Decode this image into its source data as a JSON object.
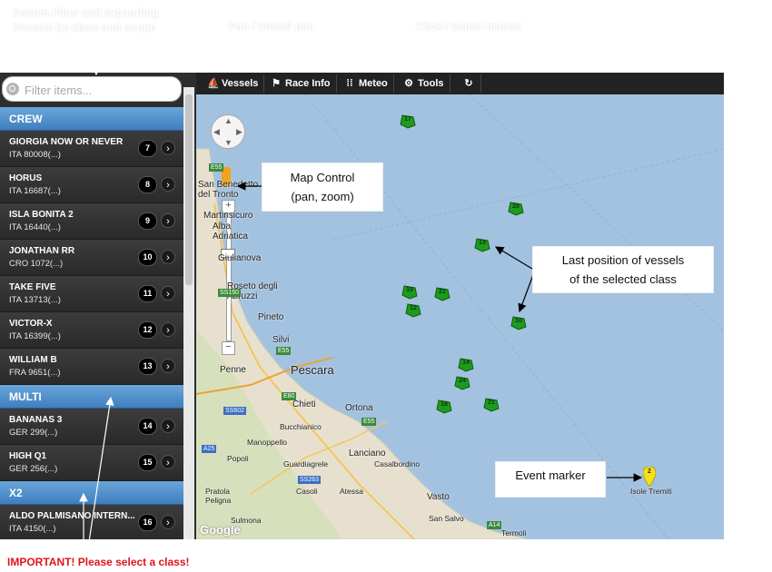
{
  "captions": {
    "filter": "Search Filter and expanding\nVessels by class and scope",
    "pan": "Pan / Vessel pan",
    "click": "Click / Select marker"
  },
  "sidebar": {
    "filter_placeholder": "Filter items...",
    "groups": [
      {
        "name": "CREW",
        "items": [
          {
            "name": "GIORGIA NOW OR NEVER",
            "id": "ITA 80008(...)",
            "count": "7"
          },
          {
            "name": "HORUS",
            "id": "ITA 16687(...)",
            "count": "8"
          },
          {
            "name": "ISLA BONITA 2",
            "id": "ITA 16440(...)",
            "count": "9"
          },
          {
            "name": "JONATHAN RR",
            "id": "CRO 1072(...)",
            "count": "10"
          },
          {
            "name": "TAKE FIVE",
            "id": "ITA 13713(...)",
            "count": "11"
          },
          {
            "name": "VICTOR-X",
            "id": "ITA 16399(...)",
            "count": "12"
          },
          {
            "name": "WILLIAM B",
            "id": "FRA 9651(...)",
            "count": "13"
          }
        ]
      },
      {
        "name": "MULTI",
        "items": [
          {
            "name": "BANANAS 3",
            "id": "GER 299(...)",
            "count": "14"
          },
          {
            "name": "HIGH Q1",
            "id": "GER 256(...)",
            "count": "15"
          }
        ]
      },
      {
        "name": "X2",
        "items": [
          {
            "name": "ALDO PALMISANO INTERN...",
            "id": "ITA 4150(...)",
            "count": "16"
          }
        ]
      }
    ]
  },
  "toolbar": {
    "vessels": "Vessels",
    "race_info": "Race Info",
    "meteo": "Meteo",
    "tools": "Tools"
  },
  "map": {
    "places": {
      "san_benedetto": "San Benedetto\ndel Tronto",
      "martinsicuro": "Martinsicuro",
      "alba_adriatica": "Alba\nAdriatica",
      "giulianova": "Giulianova",
      "roseto": "Roseto degli\nAbruzzi",
      "pineto": "Pineto",
      "silvi": "Silvi",
      "penne": "Penne",
      "pescara": "Pescara",
      "chieti": "Chieti",
      "ortona": "Ortona",
      "bucchianico": "Bucchianico",
      "manoppello": "Manoppello",
      "lanciano": "Lanciano",
      "casalbordino": "Casalbordino",
      "guardiagrele": "Guardiagrele",
      "popoli": "Popoli",
      "pratola": "Pratola\nPeligna",
      "sulmona": "Sulmona",
      "casoli": "Casoli",
      "atessa": "Atessa",
      "vasto": "Vasto",
      "san_salvo": "San Salvo",
      "termoli": "Termoli",
      "isole_tremiti": "Isole Tremiti"
    },
    "google": "Google",
    "event_marker_number": "2",
    "vessel_markers": [
      "17",
      "20",
      "13",
      "19",
      "21",
      "12",
      "10",
      "14",
      "24",
      "18",
      "21"
    ]
  },
  "annotations": {
    "map_control": "Map Control\n(pan, zoom)",
    "last_position": "Last position of vessels\nof  the selected class",
    "event_marker": "Event marker"
  },
  "important": "IMPORTANT! Please select a class!",
  "colors": {
    "sea": "#a3c2e0",
    "group_header": "#4a8ccb",
    "vessel_marker": "#1e9a1e",
    "event_marker": "#f6e01b",
    "important": "#e0141e"
  }
}
